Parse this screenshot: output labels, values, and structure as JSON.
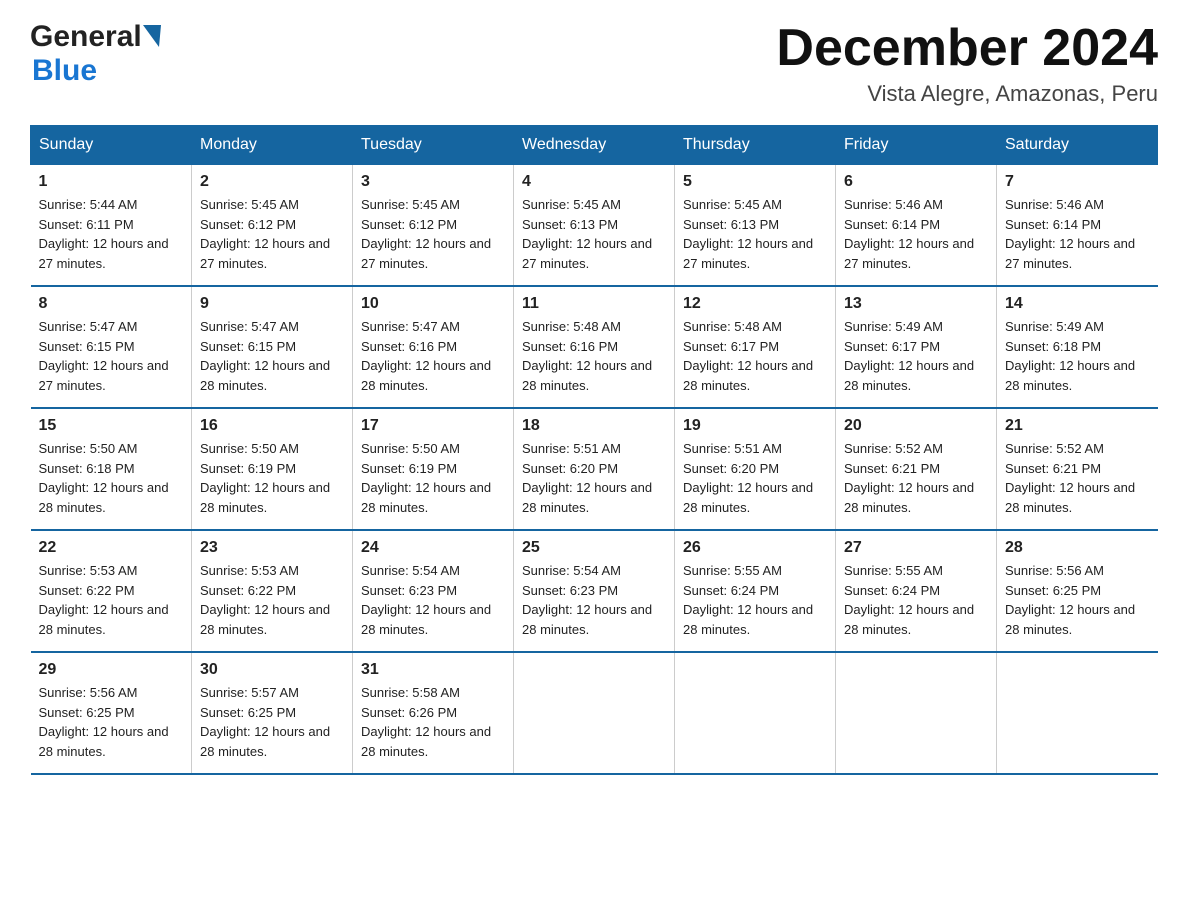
{
  "logo": {
    "line1": "General",
    "triangle": "▶",
    "line2": "Blue"
  },
  "header": {
    "month": "December 2024",
    "location": "Vista Alegre, Amazonas, Peru"
  },
  "days_of_week": [
    "Sunday",
    "Monday",
    "Tuesday",
    "Wednesday",
    "Thursday",
    "Friday",
    "Saturday"
  ],
  "weeks": [
    [
      {
        "day": "1",
        "sunrise": "5:44 AM",
        "sunset": "6:11 PM",
        "daylight": "12 hours and 27 minutes."
      },
      {
        "day": "2",
        "sunrise": "5:45 AM",
        "sunset": "6:12 PM",
        "daylight": "12 hours and 27 minutes."
      },
      {
        "day": "3",
        "sunrise": "5:45 AM",
        "sunset": "6:12 PM",
        "daylight": "12 hours and 27 minutes."
      },
      {
        "day": "4",
        "sunrise": "5:45 AM",
        "sunset": "6:13 PM",
        "daylight": "12 hours and 27 minutes."
      },
      {
        "day": "5",
        "sunrise": "5:45 AM",
        "sunset": "6:13 PM",
        "daylight": "12 hours and 27 minutes."
      },
      {
        "day": "6",
        "sunrise": "5:46 AM",
        "sunset": "6:14 PM",
        "daylight": "12 hours and 27 minutes."
      },
      {
        "day": "7",
        "sunrise": "5:46 AM",
        "sunset": "6:14 PM",
        "daylight": "12 hours and 27 minutes."
      }
    ],
    [
      {
        "day": "8",
        "sunrise": "5:47 AM",
        "sunset": "6:15 PM",
        "daylight": "12 hours and 27 minutes."
      },
      {
        "day": "9",
        "sunrise": "5:47 AM",
        "sunset": "6:15 PM",
        "daylight": "12 hours and 28 minutes."
      },
      {
        "day": "10",
        "sunrise": "5:47 AM",
        "sunset": "6:16 PM",
        "daylight": "12 hours and 28 minutes."
      },
      {
        "day": "11",
        "sunrise": "5:48 AM",
        "sunset": "6:16 PM",
        "daylight": "12 hours and 28 minutes."
      },
      {
        "day": "12",
        "sunrise": "5:48 AM",
        "sunset": "6:17 PM",
        "daylight": "12 hours and 28 minutes."
      },
      {
        "day": "13",
        "sunrise": "5:49 AM",
        "sunset": "6:17 PM",
        "daylight": "12 hours and 28 minutes."
      },
      {
        "day": "14",
        "sunrise": "5:49 AM",
        "sunset": "6:18 PM",
        "daylight": "12 hours and 28 minutes."
      }
    ],
    [
      {
        "day": "15",
        "sunrise": "5:50 AM",
        "sunset": "6:18 PM",
        "daylight": "12 hours and 28 minutes."
      },
      {
        "day": "16",
        "sunrise": "5:50 AM",
        "sunset": "6:19 PM",
        "daylight": "12 hours and 28 minutes."
      },
      {
        "day": "17",
        "sunrise": "5:50 AM",
        "sunset": "6:19 PM",
        "daylight": "12 hours and 28 minutes."
      },
      {
        "day": "18",
        "sunrise": "5:51 AM",
        "sunset": "6:20 PM",
        "daylight": "12 hours and 28 minutes."
      },
      {
        "day": "19",
        "sunrise": "5:51 AM",
        "sunset": "6:20 PM",
        "daylight": "12 hours and 28 minutes."
      },
      {
        "day": "20",
        "sunrise": "5:52 AM",
        "sunset": "6:21 PM",
        "daylight": "12 hours and 28 minutes."
      },
      {
        "day": "21",
        "sunrise": "5:52 AM",
        "sunset": "6:21 PM",
        "daylight": "12 hours and 28 minutes."
      }
    ],
    [
      {
        "day": "22",
        "sunrise": "5:53 AM",
        "sunset": "6:22 PM",
        "daylight": "12 hours and 28 minutes."
      },
      {
        "day": "23",
        "sunrise": "5:53 AM",
        "sunset": "6:22 PM",
        "daylight": "12 hours and 28 minutes."
      },
      {
        "day": "24",
        "sunrise": "5:54 AM",
        "sunset": "6:23 PM",
        "daylight": "12 hours and 28 minutes."
      },
      {
        "day": "25",
        "sunrise": "5:54 AM",
        "sunset": "6:23 PM",
        "daylight": "12 hours and 28 minutes."
      },
      {
        "day": "26",
        "sunrise": "5:55 AM",
        "sunset": "6:24 PM",
        "daylight": "12 hours and 28 minutes."
      },
      {
        "day": "27",
        "sunrise": "5:55 AM",
        "sunset": "6:24 PM",
        "daylight": "12 hours and 28 minutes."
      },
      {
        "day": "28",
        "sunrise": "5:56 AM",
        "sunset": "6:25 PM",
        "daylight": "12 hours and 28 minutes."
      }
    ],
    [
      {
        "day": "29",
        "sunrise": "5:56 AM",
        "sunset": "6:25 PM",
        "daylight": "12 hours and 28 minutes."
      },
      {
        "day": "30",
        "sunrise": "5:57 AM",
        "sunset": "6:25 PM",
        "daylight": "12 hours and 28 minutes."
      },
      {
        "day": "31",
        "sunrise": "5:58 AM",
        "sunset": "6:26 PM",
        "daylight": "12 hours and 28 minutes."
      },
      {
        "day": "",
        "sunrise": "",
        "sunset": "",
        "daylight": ""
      },
      {
        "day": "",
        "sunrise": "",
        "sunset": "",
        "daylight": ""
      },
      {
        "day": "",
        "sunrise": "",
        "sunset": "",
        "daylight": ""
      },
      {
        "day": "",
        "sunrise": "",
        "sunset": "",
        "daylight": ""
      }
    ]
  ],
  "labels": {
    "sunrise": "Sunrise:",
    "sunset": "Sunset:",
    "daylight": "Daylight:"
  }
}
